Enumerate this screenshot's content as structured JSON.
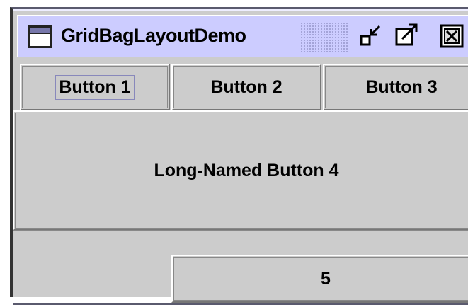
{
  "window": {
    "title": "GridBagLayoutDemo",
    "controls": [
      {
        "name": "minimize-icon"
      },
      {
        "name": "maximize-icon"
      },
      {
        "name": "close-icon"
      }
    ]
  },
  "buttons": {
    "b1": "Button 1",
    "b2": "Button 2",
    "b3": "Button 3",
    "b4": "Long-Named Button 4",
    "b5": "5"
  },
  "colors": {
    "titlebar": "#ccccff",
    "background": "#cccccc"
  }
}
